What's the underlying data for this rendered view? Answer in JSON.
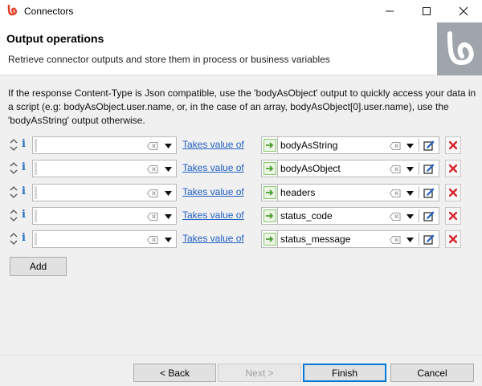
{
  "window": {
    "title": "Connectors"
  },
  "header": {
    "title": "Output operations",
    "description": "Retrieve connector outputs and store them in process or business variables"
  },
  "info_text": "If the response Content-Type is Json compatible, use the 'bodyAsObject' output to quickly access your data in a script (e.g: bodyAsObject.user.name, or, in the case of an array, bodyAsObject[0].user.name), use the 'bodyAsString' output otherwise.",
  "operations": [
    {
      "target_value": "",
      "operator": "Takes value of",
      "output": "bodyAsString"
    },
    {
      "target_value": "",
      "operator": "Takes value of",
      "output": "bodyAsObject"
    },
    {
      "target_value": "",
      "operator": "Takes value of",
      "output": "headers"
    },
    {
      "target_value": "",
      "operator": "Takes value of",
      "output": "status_code"
    },
    {
      "target_value": "",
      "operator": "Takes value of",
      "output": "status_message"
    }
  ],
  "add_label": "Add",
  "buttons": {
    "back": "< Back",
    "next": "Next >",
    "finish": "Finish",
    "cancel": "Cancel"
  },
  "colors": {
    "link": "#1f5fc4",
    "info_icon": "#2a6ebd",
    "delete_icon": "#d9232b",
    "go_arrow": "#4a9d2f",
    "brand_icon": "#e0432a",
    "logo_panel": "#9fa5ab"
  },
  "icons": {
    "app": "bonita-logo-icon",
    "minimize": "minimize-icon",
    "maximize": "maximize-icon",
    "close": "close-icon",
    "reorder": "reorder-arrows-icon",
    "info": "info-icon",
    "clear": "clear-field-icon",
    "dropdown": "chevron-down-icon",
    "output_arrow": "green-arrow-icon",
    "edit": "edit-icon",
    "delete": "delete-icon",
    "header_logo": "bonita-watermark-icon"
  }
}
